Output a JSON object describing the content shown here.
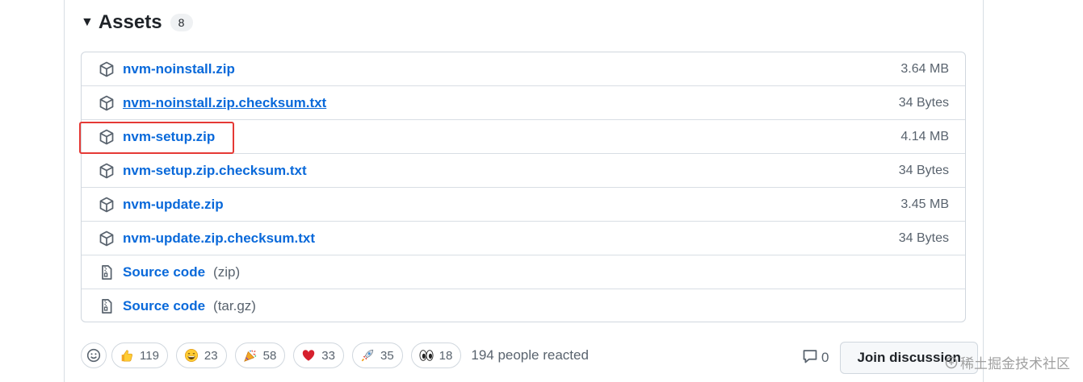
{
  "assets": {
    "caret_icon": "triangle-down-icon",
    "title": "Assets",
    "count": "8",
    "items": [
      {
        "name": "nvm-noinstall.zip",
        "size": "3.64 MB",
        "icon": "package-icon"
      },
      {
        "name": "nvm-noinstall.zip.checksum.txt",
        "size": "34 Bytes",
        "icon": "package-icon"
      },
      {
        "name": "nvm-setup.zip",
        "size": "4.14 MB",
        "icon": "package-icon"
      },
      {
        "name": "nvm-setup.zip.checksum.txt",
        "size": "34 Bytes",
        "icon": "package-icon"
      },
      {
        "name": "nvm-update.zip",
        "size": "3.45 MB",
        "icon": "package-icon"
      },
      {
        "name": "nvm-update.zip.checksum.txt",
        "size": "34 Bytes",
        "icon": "package-icon"
      },
      {
        "name": "Source code",
        "ext": "(zip)",
        "icon": "file-zip-icon"
      },
      {
        "name": "Source code",
        "ext": "(tar.gz)",
        "icon": "file-zip-icon"
      }
    ]
  },
  "reactions": {
    "items": [
      {
        "emoji": "thumbs-up",
        "count": "119"
      },
      {
        "emoji": "grinning-face",
        "count": "23"
      },
      {
        "emoji": "party-popper",
        "count": "58"
      },
      {
        "emoji": "heart",
        "count": "33"
      },
      {
        "emoji": "rocket",
        "count": "35"
      },
      {
        "emoji": "eyes",
        "count": "18"
      }
    ],
    "summary": "194 people reacted"
  },
  "discussion": {
    "comment_count": "0",
    "join_label": "Join discussion"
  },
  "watermark": "稀土掘金技术社区",
  "colors": {
    "link": "#0969da",
    "muted": "#59636e",
    "border": "#d0d7de",
    "highlight": "#e53935"
  }
}
